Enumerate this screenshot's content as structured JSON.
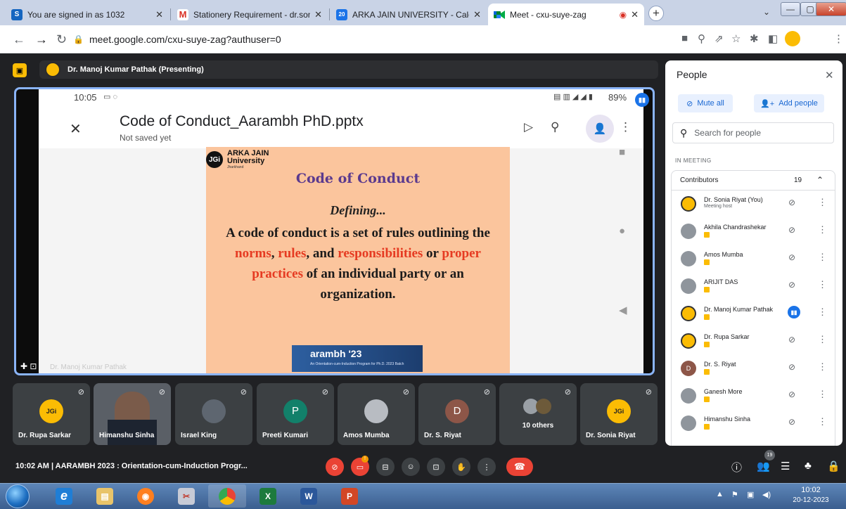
{
  "tabs": [
    {
      "label": "You are signed in as 1032",
      "favicon": "S"
    },
    {
      "label": "Stationery Requirement - dr.sonia",
      "favicon": "M"
    },
    {
      "label": "ARKA JAIN UNIVERSITY - Calend",
      "favicon": "20"
    },
    {
      "label": "Meet - cxu-suye-zag",
      "favicon": "meet"
    }
  ],
  "url": "meet.google.com/cxu-suye-zag?authuser=0",
  "presenter_bar": "Dr. Manoj Kumar Pathak (Presenting)",
  "phone": {
    "time": "10:05",
    "battery": "89%",
    "doc_title": "Code of Conduct_Aarambh PhD.pptx",
    "doc_status": "Not saved yet"
  },
  "slide": {
    "logo_line1": "ARKA JAIN",
    "logo_line2": "University",
    "logo_sub": "Jharkhand",
    "logo_mark": "JGi",
    "title": "Code of Conduct",
    "defining": "Defining...",
    "body_a": "A code of conduct is a set of rules outlining the ",
    "body_norms": "norms",
    "body_comma1": ", ",
    "body_rules": "rules",
    "body_and": ", and ",
    "body_resp": "responsibilities",
    "body_or": " or ",
    "body_proper": "proper practices",
    "body_end": " of an individual party or an organization.",
    "banner": "arambh '23",
    "banner_sub": "An Orientation-cum-Induction Program for Ph.D. 2023 Batch"
  },
  "stage_name": "Dr. Manoj Kumar Pathak",
  "tiles": [
    {
      "name": "Dr. Rupa Sarkar",
      "kind": "logo"
    },
    {
      "name": "Himanshu Sinha",
      "kind": "photo"
    },
    {
      "name": "Israel King",
      "kind": "photo"
    },
    {
      "name": "Preeti Kumari",
      "kind": "letter",
      "letter": "P",
      "color": "#12806a"
    },
    {
      "name": "Amos Mumba",
      "kind": "photo"
    },
    {
      "name": "Dr. S. Riyat",
      "kind": "letter",
      "letter": "D",
      "color": "#8d5648"
    },
    {
      "name": "10 others",
      "kind": "group"
    },
    {
      "name": "Dr. Sonia Riyat",
      "kind": "logo"
    }
  ],
  "people": {
    "title": "People",
    "mute_all": "Mute all",
    "add_people": "Add people",
    "search_placeholder": "Search for people",
    "in_meeting": "IN MEETING",
    "contributors_label": "Contributors",
    "contributors_count": "19",
    "list": [
      {
        "name": "Dr. Sonia Riyat (You)",
        "sub": "Meeting host",
        "avatar": "logo",
        "state": "muted"
      },
      {
        "name": "Akhila Chandrashekar",
        "sub": "",
        "avatar": "photo",
        "state": "muted"
      },
      {
        "name": "Amos Mumba",
        "sub": "",
        "avatar": "photo",
        "state": "muted"
      },
      {
        "name": "ARIJIT DAS",
        "sub": "",
        "avatar": "photo",
        "state": "muted"
      },
      {
        "name": "Dr. Manoj Kumar Pathak",
        "sub": "",
        "avatar": "logo",
        "state": "speaking"
      },
      {
        "name": "Dr. Rupa Sarkar",
        "sub": "",
        "avatar": "logo",
        "state": "muted"
      },
      {
        "name": "Dr. S. Riyat",
        "sub": "",
        "avatar": "letter",
        "letter": "D",
        "state": "muted"
      },
      {
        "name": "Ganesh More",
        "sub": "",
        "avatar": "photo",
        "state": "muted"
      },
      {
        "name": "Himanshu Sinha",
        "sub": "",
        "avatar": "photo",
        "state": "muted"
      }
    ]
  },
  "footer": {
    "meeting_info": "10:02 AM | AARAMBH 2023 : Orientation-cum-Induction Progr...",
    "people_count": "19"
  },
  "taskbar": {
    "time": "10:02",
    "date": "20-12-2023"
  },
  "colors": {
    "accent": "#8ab4f8",
    "meet_bg": "#202124",
    "hangup": "#ea4335",
    "brand_yellow": "#fbbc04",
    "slide_bg": "#fbc59d",
    "slide_title": "#5b3a8e",
    "slide_red": "#e63b22"
  }
}
